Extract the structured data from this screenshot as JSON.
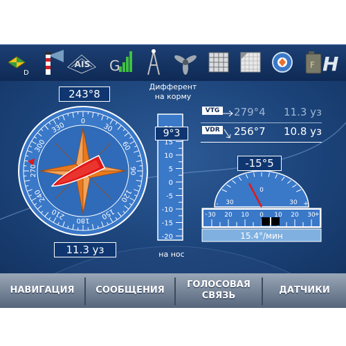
{
  "toolbar": {
    "icons": [
      "anchor-icon",
      "lighthouse-icon",
      "ais-icon",
      "signal-bars-icon",
      "mast-icon",
      "propeller-icon",
      "grid-icon",
      "chart-icon",
      "target-icon",
      "canister-icon",
      "helicopter-icon"
    ],
    "ais_label": "AIS",
    "dot_label": "D",
    "fuel_label": "F",
    "heli_label": "H"
  },
  "compass": {
    "heading": "243°8",
    "speed": "11.3 уз",
    "ticks": [
      "0",
      "30",
      "60",
      "90",
      "120",
      "150",
      "180",
      "210",
      "240",
      "270",
      "300",
      "330"
    ]
  },
  "trim": {
    "title_line1": "Дифферент",
    "title_line2": "на корму",
    "value": "9°3",
    "scale": [
      "20",
      "15",
      "10",
      "5",
      "0",
      "-5",
      "-10",
      "-15",
      "-20"
    ],
    "bottom_label": "на нос"
  },
  "nav": {
    "vtg_label": "VTG",
    "vtg_course": "279°4",
    "vtg_speed": "11.3 уз",
    "vdr_label": "VDR",
    "vdr_course": "256°7",
    "vdr_speed": "10.8 уз"
  },
  "rot": {
    "angle": "-15°5",
    "arc_labels": [
      "30",
      "0",
      "30"
    ],
    "arc_signs": [
      "-",
      "+"
    ],
    "scale": [
      "30",
      "20",
      "10",
      "0",
      "10",
      "20",
      "30"
    ],
    "scale_signs": [
      "-",
      "+"
    ],
    "rate": "15.4°/мин"
  },
  "menu": {
    "tabs": [
      {
        "label": "НАВИГАЦИЯ"
      },
      {
        "label": "СООБЩЕНИЯ"
      },
      {
        "label1": "ГОЛОСОВАЯ",
        "label2": "СВЯЗЬ"
      },
      {
        "label": "ДАТЧИКИ"
      }
    ]
  },
  "colors": {
    "bg": "#1b4379",
    "accent": "#e8791e",
    "ship": "#e01818",
    "panel": "#0f3670"
  }
}
